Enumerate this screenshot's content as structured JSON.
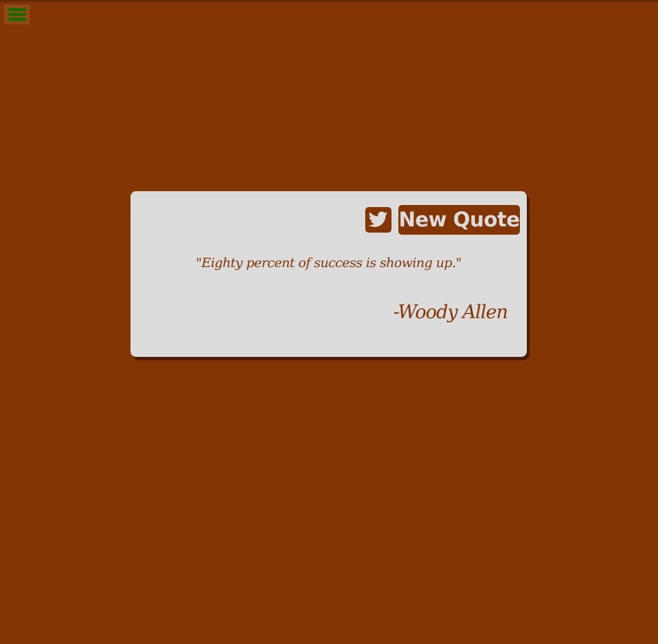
{
  "menu": {
    "icon": "hamburger-menu-icon",
    "bar_color": "#0d6e04"
  },
  "card": {
    "tweet_icon": "twitter-icon",
    "new_quote_label": "New Quote",
    "quote": "\"Eighty percent of success is showing up.\"",
    "author": "-Woody Allen"
  },
  "colors": {
    "background": "#843504",
    "card": "#dcdcdc",
    "accent": "#843504"
  }
}
